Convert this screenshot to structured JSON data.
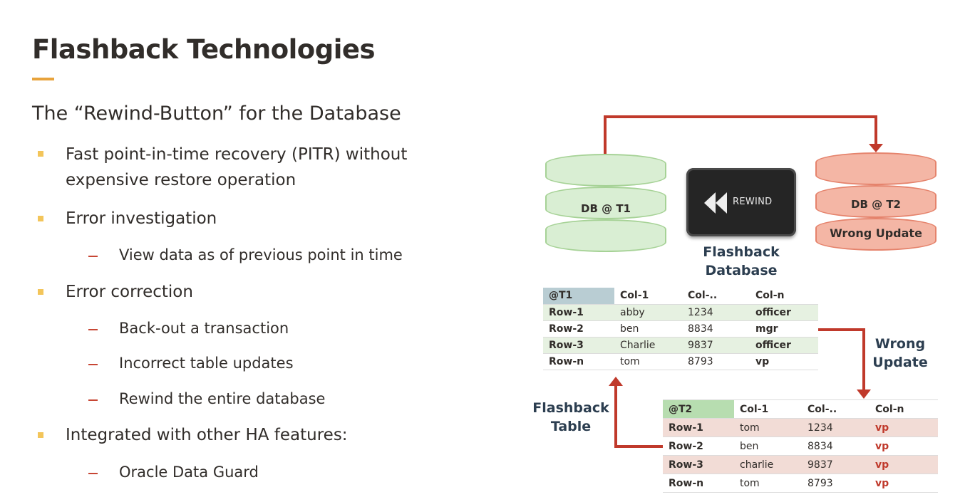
{
  "slide": {
    "title": "Flashback Technologies",
    "subtitle": "The “Rewind-Button” for the Database",
    "bullets": [
      {
        "text": "Fast point-in-time recovery (PITR) without expensive restore operation",
        "level": 1
      },
      {
        "text": "Error investigation",
        "level": 1
      },
      {
        "text": "View data as of previous point in time",
        "level": 2
      },
      {
        "text": "Error correction",
        "level": 1
      },
      {
        "text": "Back-out a transaction",
        "level": 2
      },
      {
        "text": "Incorrect table updates",
        "level": 2
      },
      {
        "text": "Rewind the entire database",
        "level": 2
      },
      {
        "text": "Integrated with other HA features:",
        "level": 1
      },
      {
        "text": "Oracle Data Guard",
        "level": 2
      }
    ]
  },
  "diagram": {
    "db_t1": {
      "label": "DB @ T1"
    },
    "db_t2": {
      "label": "DB @ T2",
      "note": "Wrong Update"
    },
    "rewind_button": {
      "label": "REWIND"
    },
    "flashback_database": "Flashback Database",
    "flashback_table": "Flashback Table",
    "wrong_update": "Wrong Update",
    "colors": {
      "green": "#d9eed3",
      "red": "#f4b6a5",
      "arrow": "#c0392b",
      "vp": "#c0392b"
    },
    "table_t1": {
      "header": [
        "@T1",
        "Col-1",
        "Col-..",
        "Col-n"
      ],
      "rows": [
        [
          "Row-1",
          "abby",
          "1234",
          "officer"
        ],
        [
          "Row-2",
          "ben",
          "8834",
          "mgr"
        ],
        [
          "Row-3",
          "Charlie",
          "9837",
          "officer"
        ],
        [
          "Row-n",
          "tom",
          "8793",
          "vp"
        ]
      ]
    },
    "table_t2": {
      "header": [
        "@T2",
        "Col-1",
        "Col-..",
        "Col-n"
      ],
      "rows": [
        [
          "Row-1",
          "tom",
          "1234",
          "vp"
        ],
        [
          "Row-2",
          "ben",
          "8834",
          "vp"
        ],
        [
          "Row-3",
          "charlie",
          "9837",
          "vp"
        ],
        [
          "Row-n",
          "tom",
          "8793",
          "vp"
        ]
      ]
    }
  }
}
